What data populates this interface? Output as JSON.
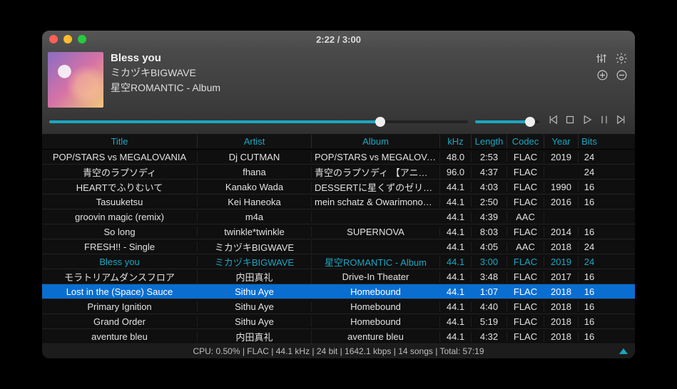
{
  "titlebar": {
    "time": "2:22 / 3:00"
  },
  "now_playing": {
    "title": "Bless you",
    "artist": "ミカヅキBIGWAVE",
    "album": "星空ROMANTIC - Album"
  },
  "seek": {
    "percent": 79
  },
  "volume": {
    "percent": 86
  },
  "columns": {
    "title": "Title",
    "artist": "Artist",
    "album": "Album",
    "khz": "kHz",
    "length": "Length",
    "codec": "Codec",
    "year": "Year",
    "bits": "Bits"
  },
  "tracks": [
    {
      "title": "POP/STARS vs MEGALOVANIA",
      "artist": "Dj CUTMAN",
      "album": "POP/STARS vs MEGALOVANIA",
      "khz": "48.0",
      "length": "2:53",
      "codec": "FLAC",
      "year": "2019",
      "bits": "24",
      "state": ""
    },
    {
      "title": "青空のラプソディ",
      "artist": "fhana",
      "album": "青空のラプソディ 【アニメ盤】",
      "khz": "96.0",
      "length": "4:37",
      "codec": "FLAC",
      "year": "",
      "bits": "24",
      "state": ""
    },
    {
      "title": "HEARTでふりむいて",
      "artist": "Kanako Wada",
      "album": "DESSERTに星くずのゼリーを",
      "khz": "44.1",
      "length": "4:03",
      "codec": "FLAC",
      "year": "1990",
      "bits": "16",
      "state": ""
    },
    {
      "title": "Tasuuketsu",
      "artist": "Kei Haneoka",
      "album": "mein schatz & Owarimonogat...",
      "khz": "44.1",
      "length": "2:50",
      "codec": "FLAC",
      "year": "2016",
      "bits": "16",
      "state": ""
    },
    {
      "title": "groovin magic (remix)",
      "artist": "m4a",
      "album": "",
      "khz": "44.1",
      "length": "4:39",
      "codec": "AAC",
      "year": "",
      "bits": "",
      "state": ""
    },
    {
      "title": "So long",
      "artist": "twinkle*twinkle",
      "album": "SUPERNOVA",
      "khz": "44.1",
      "length": "8:03",
      "codec": "FLAC",
      "year": "2014",
      "bits": "16",
      "state": ""
    },
    {
      "title": "FRESH!! - Single",
      "artist": "ミカヅキBIGWAVE",
      "album": "",
      "khz": "44.1",
      "length": "4:05",
      "codec": "AAC",
      "year": "2018",
      "bits": "24",
      "state": ""
    },
    {
      "title": "Bless you",
      "artist": "ミカヅキBIGWAVE",
      "album": "星空ROMANTIC - Album",
      "khz": "44.1",
      "length": "3:00",
      "codec": "FLAC",
      "year": "2019",
      "bits": "24",
      "state": "playing"
    },
    {
      "title": "モラトリアムダンスフロア",
      "artist": "内田真礼",
      "album": "Drive-In Theater",
      "khz": "44.1",
      "length": "3:48",
      "codec": "FLAC",
      "year": "2017",
      "bits": "16",
      "state": ""
    },
    {
      "title": "Lost in the (Space) Sauce",
      "artist": "Sithu Aye",
      "album": "Homebound",
      "khz": "44.1",
      "length": "1:07",
      "codec": "FLAC",
      "year": "2018",
      "bits": "16",
      "state": "selected"
    },
    {
      "title": "Primary Ignition",
      "artist": "Sithu Aye",
      "album": "Homebound",
      "khz": "44.1",
      "length": "4:40",
      "codec": "FLAC",
      "year": "2018",
      "bits": "16",
      "state": ""
    },
    {
      "title": "Grand Order",
      "artist": "Sithu Aye",
      "album": "Homebound",
      "khz": "44.1",
      "length": "5:19",
      "codec": "FLAC",
      "year": "2018",
      "bits": "16",
      "state": ""
    },
    {
      "title": "aventure bleu",
      "artist": "内田真礼",
      "album": "aventure bleu",
      "khz": "44.1",
      "length": "4:32",
      "codec": "FLAC",
      "year": "2018",
      "bits": "16",
      "state": ""
    }
  ],
  "status": "CPU: 0.50% | FLAC | 44.1 kHz | 24 bit | 1642.1 kbps | 14 songs | Total: 57:19",
  "icons": {
    "eq": "equalizer-icon",
    "gear": "gear-icon",
    "plus": "plus-icon",
    "minus": "minus-icon",
    "prev": "previous-icon",
    "stop": "stop-icon",
    "play": "play-icon",
    "pause": "pause-icon",
    "next": "next-icon"
  }
}
